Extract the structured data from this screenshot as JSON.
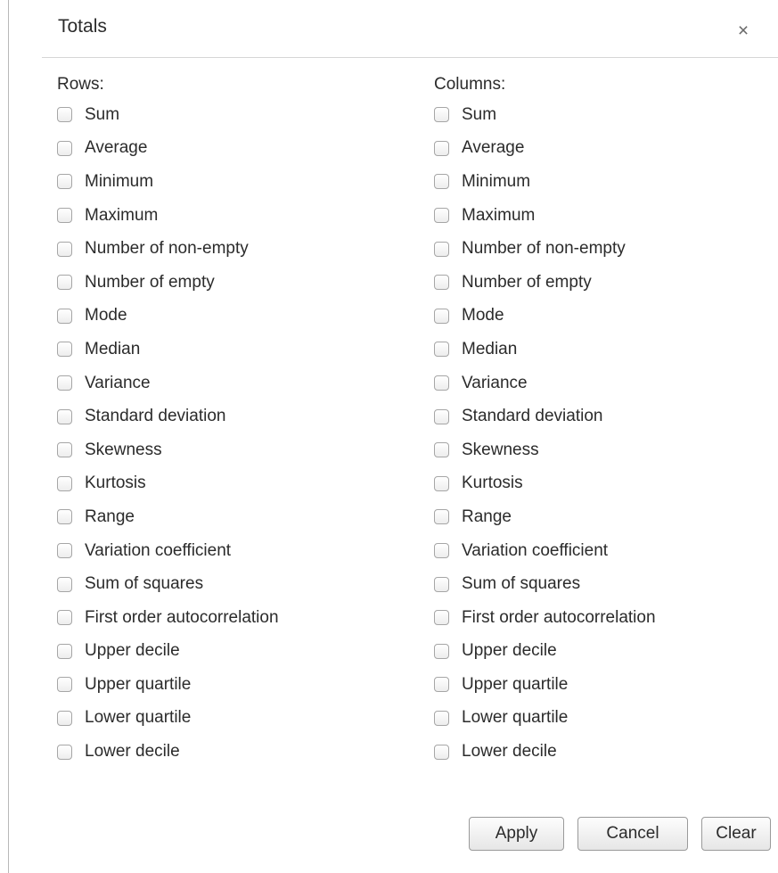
{
  "dialog": {
    "title": "Totals",
    "close_symbol": "×",
    "close_icon": "close-icon"
  },
  "rows": {
    "label": "Rows:",
    "options": [
      {
        "label": "Sum",
        "checked": false
      },
      {
        "label": "Average",
        "checked": false
      },
      {
        "label": "Minimum",
        "checked": false
      },
      {
        "label": "Maximum",
        "checked": false
      },
      {
        "label": "Number of non-empty",
        "checked": false
      },
      {
        "label": "Number of empty",
        "checked": false
      },
      {
        "label": "Mode",
        "checked": false
      },
      {
        "label": "Median",
        "checked": false
      },
      {
        "label": "Variance",
        "checked": false
      },
      {
        "label": "Standard deviation",
        "checked": false
      },
      {
        "label": "Skewness",
        "checked": false
      },
      {
        "label": "Kurtosis",
        "checked": false
      },
      {
        "label": "Range",
        "checked": false
      },
      {
        "label": "Variation coefficient",
        "checked": false
      },
      {
        "label": "Sum of squares",
        "checked": false
      },
      {
        "label": "First order autocorrelation",
        "checked": false
      },
      {
        "label": "Upper decile",
        "checked": false
      },
      {
        "label": "Upper quartile",
        "checked": false
      },
      {
        "label": "Lower quartile",
        "checked": false
      },
      {
        "label": "Lower decile",
        "checked": false
      }
    ]
  },
  "columns": {
    "label": "Columns:",
    "options": [
      {
        "label": "Sum",
        "checked": false
      },
      {
        "label": "Average",
        "checked": false
      },
      {
        "label": "Minimum",
        "checked": false
      },
      {
        "label": "Maximum",
        "checked": false
      },
      {
        "label": "Number of non-empty",
        "checked": false
      },
      {
        "label": "Number of empty",
        "checked": false
      },
      {
        "label": "Mode",
        "checked": false
      },
      {
        "label": "Median",
        "checked": false
      },
      {
        "label": "Variance",
        "checked": false
      },
      {
        "label": "Standard deviation",
        "checked": false
      },
      {
        "label": "Skewness",
        "checked": false
      },
      {
        "label": "Kurtosis",
        "checked": false
      },
      {
        "label": "Range",
        "checked": false
      },
      {
        "label": "Variation coefficient",
        "checked": false
      },
      {
        "label": "Sum of squares",
        "checked": false
      },
      {
        "label": "First order autocorrelation",
        "checked": false
      },
      {
        "label": "Upper decile",
        "checked": false
      },
      {
        "label": "Upper quartile",
        "checked": false
      },
      {
        "label": "Lower quartile",
        "checked": false
      },
      {
        "label": "Lower decile",
        "checked": false
      }
    ]
  },
  "buttons": {
    "apply": "Apply",
    "cancel": "Cancel",
    "clear": "Clear"
  }
}
